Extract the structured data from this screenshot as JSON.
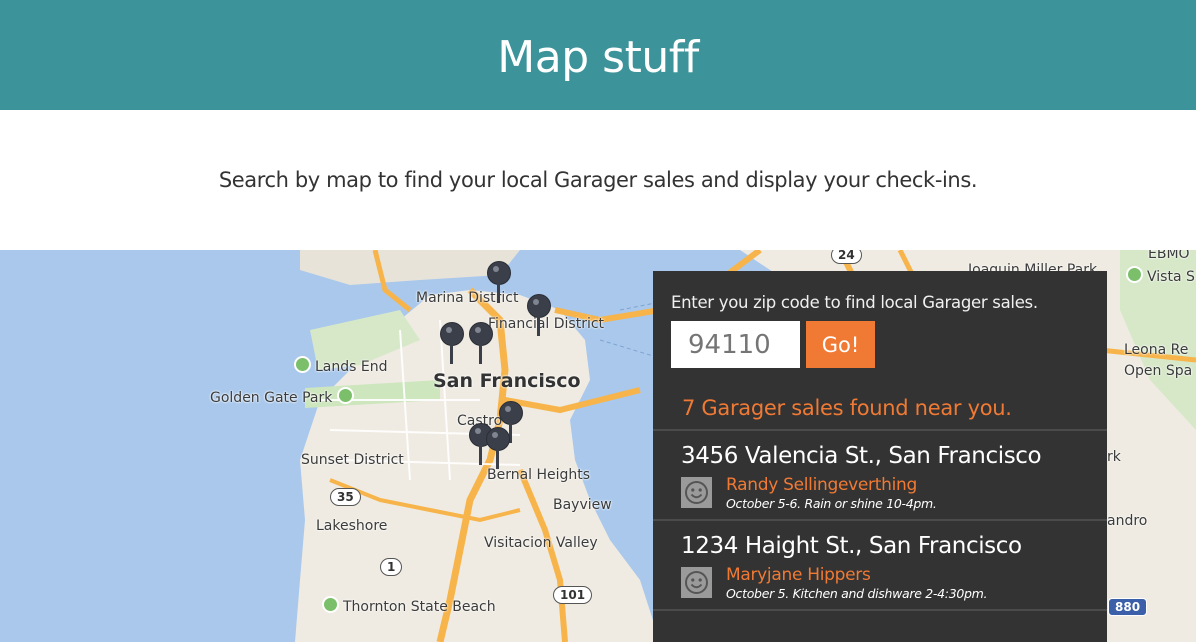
{
  "header": {
    "title": "Map stuff"
  },
  "intro": {
    "text": "Search by map to find your local Garager sales and display your check-ins."
  },
  "map": {
    "labels": {
      "marina": "Marina District",
      "financial": "Financial District",
      "lands_end": "Lands End",
      "san_francisco": "San Francisco",
      "golden_gate": "Golden Gate Park",
      "castro": "Castro",
      "sunset": "Sunset District",
      "bernal": "Bernal Heights",
      "bayview": "Bayview",
      "lakeshore": "Lakeshore",
      "visitacion": "Visitacion Valley",
      "thornton": "Thornton State Beach",
      "emeryville": "EBMO",
      "vista": "Vista S",
      "joaquin": "Joaquin Miller Park",
      "leona": "Leona Re",
      "open_space": "Open Spa",
      "k": "rk",
      "andro": "andro"
    },
    "shields": {
      "r24": "24",
      "r35": "35",
      "r1": "1",
      "r101": "101",
      "r880": "880"
    },
    "colors": {
      "water": "#a9c8ec",
      "land": "#efebe2",
      "park": "#cde6bd",
      "highway": "#f7b44a"
    }
  },
  "search": {
    "prompt": "Enter you zip code to find local Garager sales.",
    "zip_placeholder": "94110",
    "go_label": "Go!",
    "results_count_text": "7 Garager sales found near you."
  },
  "results": [
    {
      "address": "3456 Valencia St., San Francisco",
      "seller": "Randy Sellingeverthing",
      "details": "October 5-6. Rain or shine 10-4pm."
    },
    {
      "address": "1234 Haight St., San Francisco",
      "seller": "Maryjane Hippers",
      "details": "October 5. Kitchen and dishware 2-4:30pm."
    }
  ],
  "theme": {
    "header_bg": "#3c9399",
    "accent": "#f07a34",
    "panel_bg": "#333333"
  }
}
